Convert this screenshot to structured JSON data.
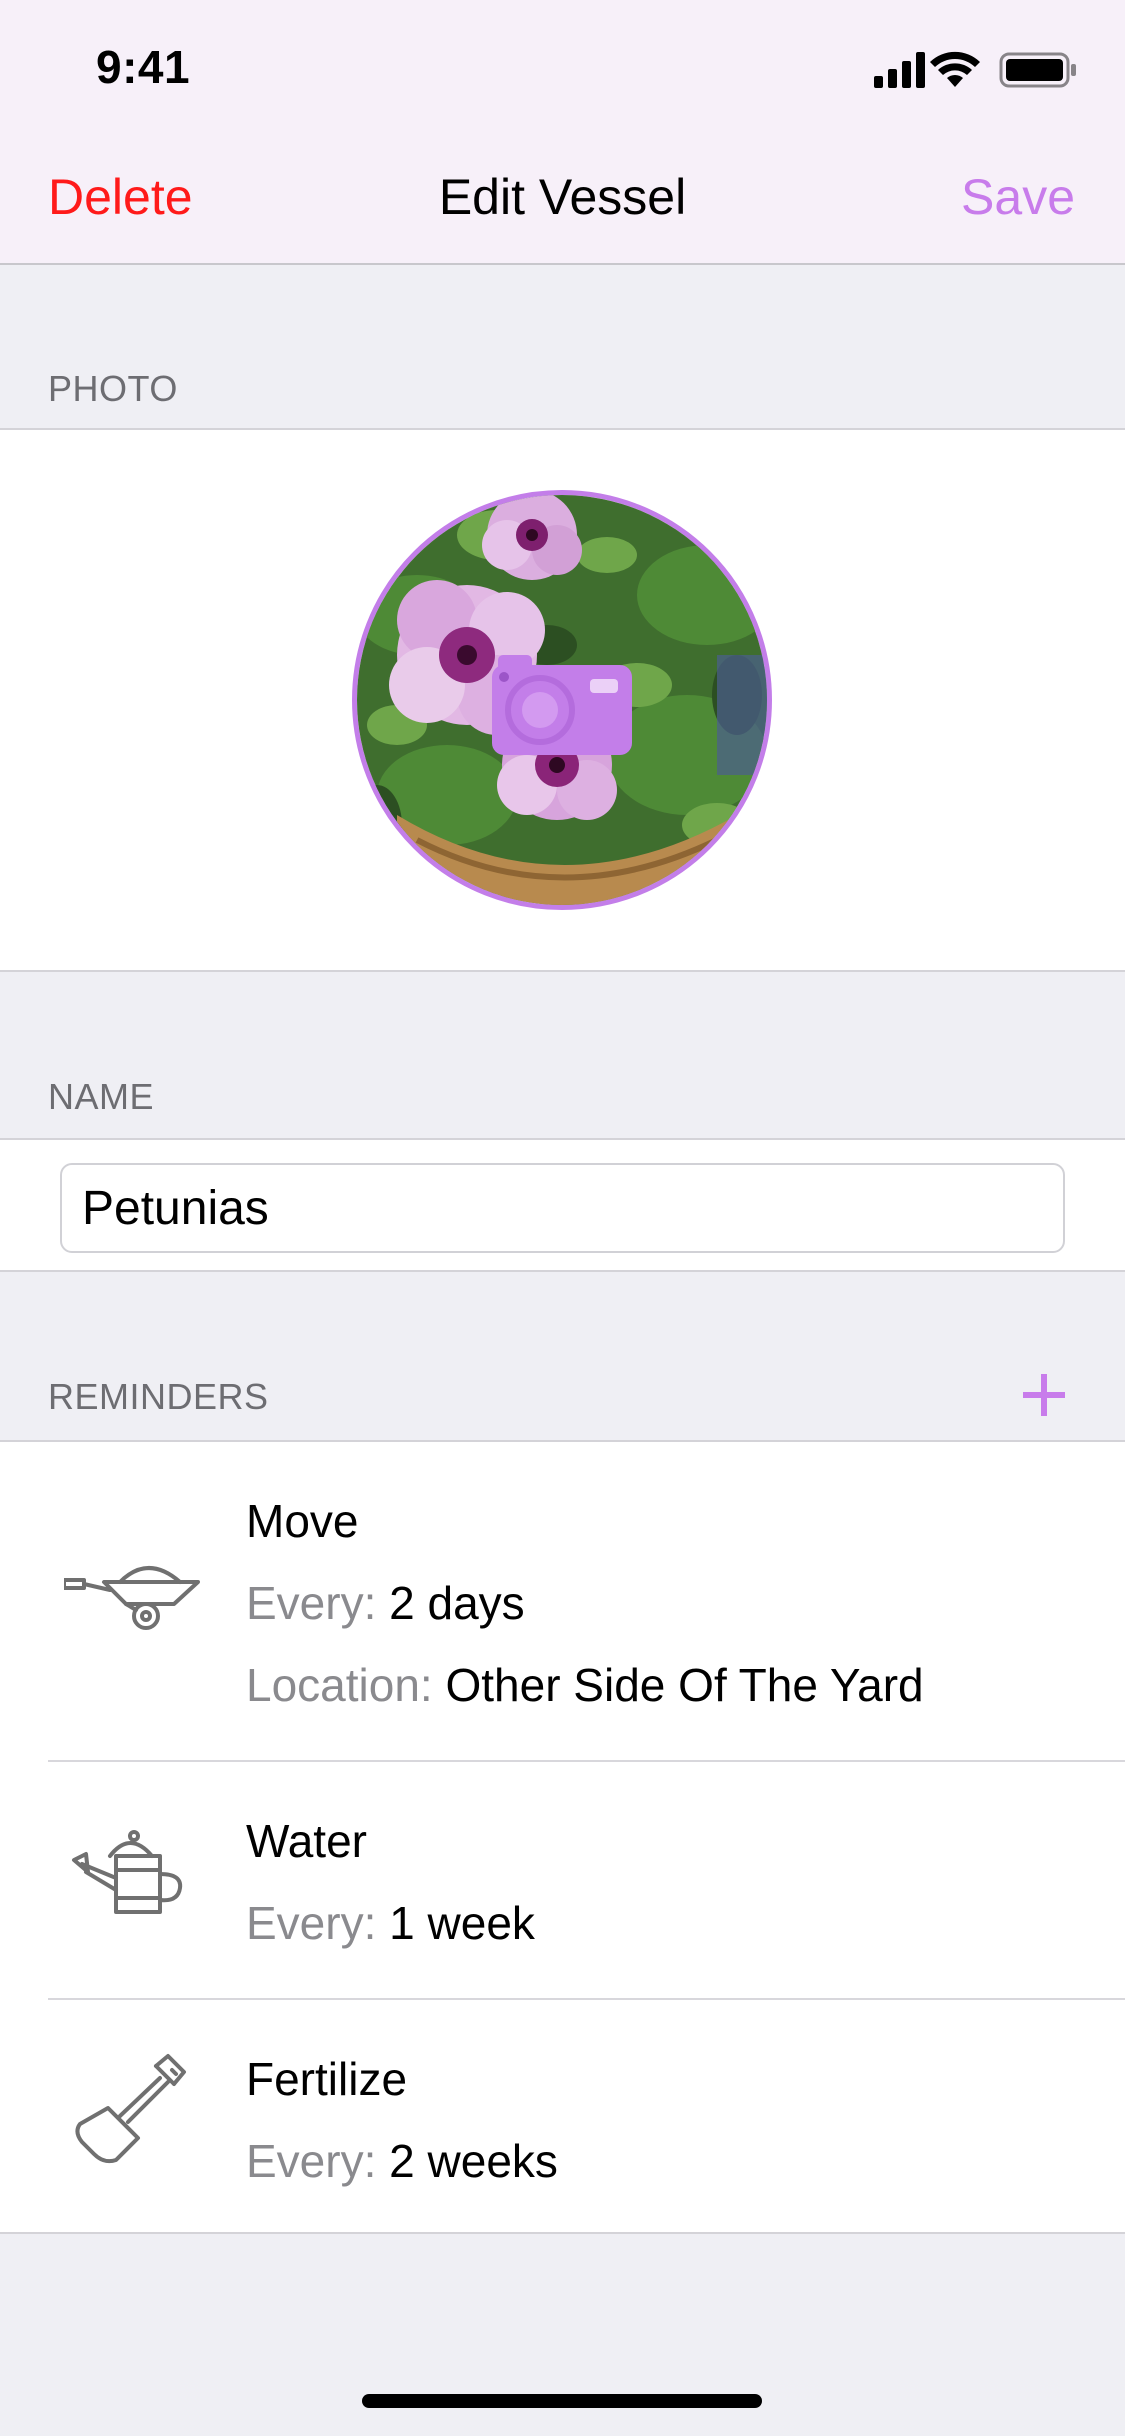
{
  "status_bar": {
    "time": "9:41",
    "icons": [
      "signal-icon",
      "wifi-icon",
      "battery-icon"
    ]
  },
  "nav": {
    "left_label": "Delete",
    "title": "Edit Vessel",
    "right_label": "Save"
  },
  "photo_section": {
    "header": "PHOTO",
    "overlay_icon": "camera-icon"
  },
  "name_section": {
    "header": "NAME",
    "value": "Petunias"
  },
  "reminders_section": {
    "header": "REMINDERS",
    "add_icon": "plus-icon",
    "items": [
      {
        "icon": "wheelbarrow-icon",
        "title": "Move",
        "every_label": "Every:",
        "every_value": "2 days",
        "location_label": "Location:",
        "location_value": "Other Side Of The Yard"
      },
      {
        "icon": "watering-can-icon",
        "title": "Water",
        "every_label": "Every:",
        "every_value": "1 week"
      },
      {
        "icon": "shovel-icon",
        "title": "Fertilize",
        "every_label": "Every:",
        "every_value": "2 weeks"
      }
    ]
  },
  "colors": {
    "accent": "#C87CEB",
    "destructive": "#FF1A1A",
    "background": "#EFEFF4",
    "nav_background": "#F7F0F9"
  }
}
